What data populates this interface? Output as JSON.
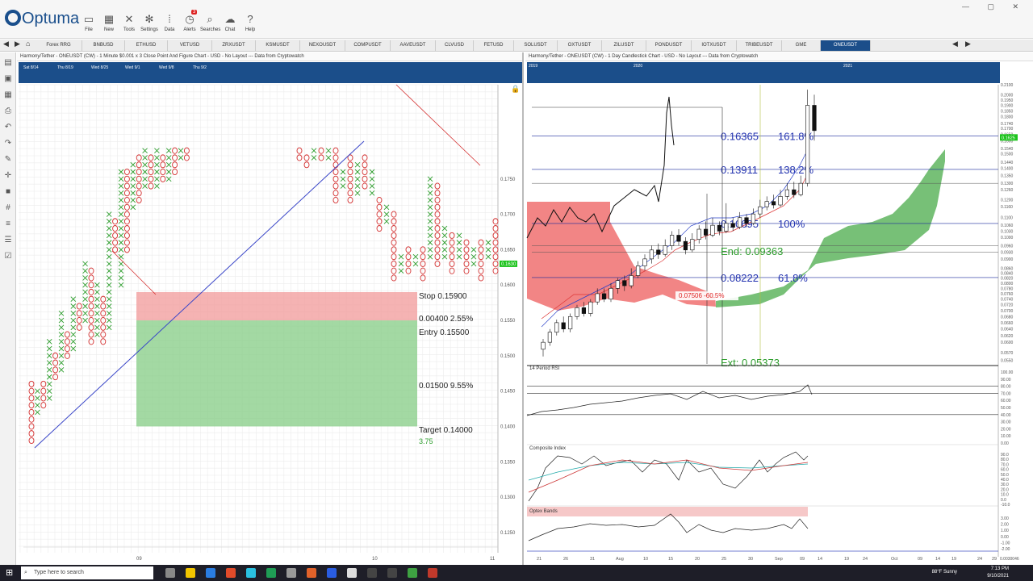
{
  "app": {
    "logo": "Optuma"
  },
  "toolbar": [
    {
      "label": "File",
      "icon": "folder-icon"
    },
    {
      "label": "New",
      "icon": "grid-icon"
    },
    {
      "label": "Tools",
      "icon": "tools-icon"
    },
    {
      "label": "Settings",
      "icon": "gear-icon"
    },
    {
      "label": "Data",
      "icon": "binary-data-icon"
    },
    {
      "label": "Alerts",
      "icon": "alarm-clock-icon",
      "badge": "3"
    },
    {
      "label": "Searches",
      "icon": "magnifier-icon"
    },
    {
      "label": "Chat",
      "icon": "chat-bubbles-icon"
    },
    {
      "label": "Help",
      "icon": "question-icon"
    }
  ],
  "tabs": [
    "Forex RRG",
    "BNBUSD",
    "ETHUSD",
    "VETUSD",
    "ZRXUSDT",
    "KSMUSDT",
    "NEXOUSDT",
    "COMPUSDT",
    "AAVEUSDT",
    "CLVUSD",
    "FETUSD",
    "SOLUSDT",
    "OXTUSDT",
    "ZILUSDT",
    "PONDUSDT",
    "IOTXUSDT",
    "TRIBEUSDT",
    "GME",
    "ONEUSDT"
  ],
  "active_tab": "ONEUSDT",
  "left_chart": {
    "title": "Harmony/Tether - ONEUSDT (CW) - 1 Minute $0.001 x 3 Close Point And Figure Chart - USD - No Layout --- Data from Cryptowatch",
    "overview_dates": [
      "Sat 8/14",
      "Thu 8/19",
      "Wed 8/25",
      "Wed 9/1",
      "Wed 9/8",
      "Thu 9/2"
    ],
    "price_labels": [
      "0.1750",
      "0.1700",
      "0.1650",
      "0.1600",
      "0.1550",
      "0.1500",
      "0.1450",
      "0.1400",
      "0.1350",
      "0.1300",
      "0.1250"
    ],
    "last_price": "0.1630",
    "x_labels": [
      "09",
      "10",
      "11"
    ],
    "trade": {
      "stop": "Stop  0.15900",
      "risk": "0.00400   2.55%",
      "entry": "Entry  0.15500",
      "reward": "0.01500   9.55%",
      "target": "Target  0.14000",
      "ratio": "3.75"
    },
    "colors": {
      "x_mark": "#2e9e2e",
      "o_mark": "#d43030",
      "trend": "#3a46c8"
    }
  },
  "right_chart": {
    "title": "Harmony/Tether - ONEUSDT (CW) - 1 Day Candlestick Chart - USD - No Layout --- Data from Cryptowatch",
    "overview_years": [
      "2019",
      "2020",
      "2021"
    ],
    "price_labels": [
      "0.2100",
      "0.2000",
      "0.1950",
      "0.1900",
      "0.1850",
      "0.1800",
      "0.1740",
      "0.1700",
      "0.1650",
      "0.1600",
      "0.1540",
      "0.1500",
      "0.1440",
      "0.1400",
      "0.1350",
      "0.1300",
      "0.1260",
      "0.1200",
      "0.1160",
      "0.1100",
      "0.1060",
      "0.1030",
      "0.1000",
      "0.0960",
      "0.0930",
      "0.0900",
      "0.0860",
      "0.0840",
      "0.0820",
      "0.0800",
      "0.0780",
      "0.0760",
      "0.0740",
      "0.0720",
      "0.0700",
      "0.0680",
      "0.0660",
      "0.0640",
      "0.0620",
      "0.0600",
      "0.0570",
      "0.0550"
    ],
    "last_price": "0.1625",
    "fib": [
      {
        "price": "0.16365",
        "pct": "161.8%"
      },
      {
        "price": "0.13911",
        "pct": "138.2%"
      },
      {
        "price": "0.10695",
        "pct": "100%"
      },
      {
        "price": "0.08222",
        "pct": "61.8%"
      }
    ],
    "end_label": "End: 0.09363",
    "ext_label": "Ext: 0.05373",
    "retrace_label": "0.07506  -60.5%",
    "x_labels": [
      "21",
      "26",
      "31",
      "Aug",
      "10",
      "15",
      "20",
      "25",
      "30",
      "Sep",
      "09",
      "14",
      "19",
      "24",
      "Oct",
      "09",
      "14",
      "19",
      "24",
      "29"
    ],
    "x_end_label": "0.0030046",
    "rsi": {
      "title": "14 Period RSI",
      "labels": [
        "100.00",
        "90.00",
        "80.00",
        "70.00",
        "60.00",
        "50.00",
        "40.00",
        "30.00",
        "20.00",
        "10.00",
        "0.00"
      ]
    },
    "composite": {
      "title": "Composite Index",
      "labels": [
        "90.0",
        "80.0",
        "70.0",
        "60.0",
        "50.0",
        "40.0",
        "30.0",
        "20.0",
        "10.0",
        "0.0",
        "-10.0"
      ]
    },
    "optex": {
      "title": "Optex Bands",
      "labels": [
        "3.00",
        "2.00",
        "1.00",
        "0.00",
        "-1.00",
        "-2.00"
      ]
    }
  },
  "taskbar": {
    "search_placeholder": "Type here to search",
    "weather": "88°F  Sunny",
    "time": "7:13 PM",
    "date": "9/10/2021"
  }
}
